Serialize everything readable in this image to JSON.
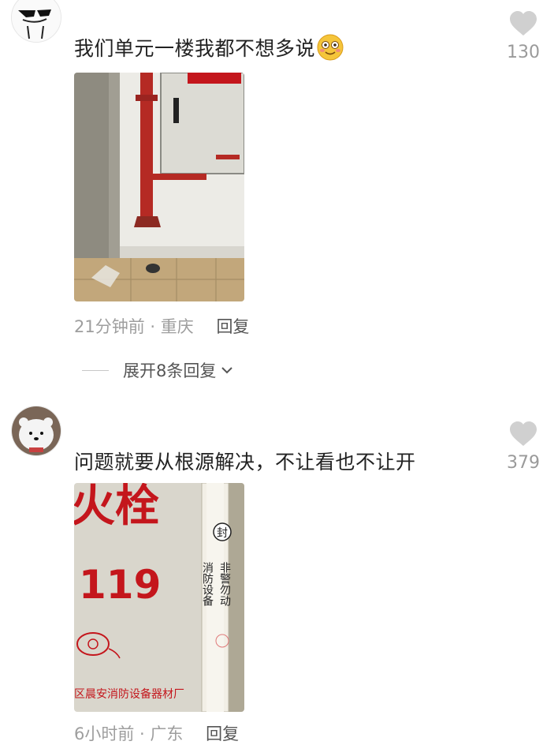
{
  "comments": [
    {
      "text": "我们单元一楼我都不想多说",
      "emoji": "smiling-blush-emoji",
      "likes": "130",
      "time": "21分钟前 · 重庆",
      "reply_label": "回复",
      "expand_label": "展开8条回复"
    },
    {
      "text": "问题就要从根源解决，不让看也不让开",
      "likes": "379",
      "time": "6小时前 · 广东",
      "reply_label": "回复",
      "photo_text": {
        "big_chars": "火栓",
        "number": "119",
        "tag_seal": "封",
        "tag_col1": "消防设备",
        "tag_col2": "非警勿动",
        "maker": "区晨安消防设备器材厂"
      }
    }
  ],
  "colors": {
    "heart": "#d0d0d0",
    "meta": "#9e9e9e",
    "text": "#222222",
    "pipe": "#b52a24",
    "sign_red": "#c4161c"
  }
}
